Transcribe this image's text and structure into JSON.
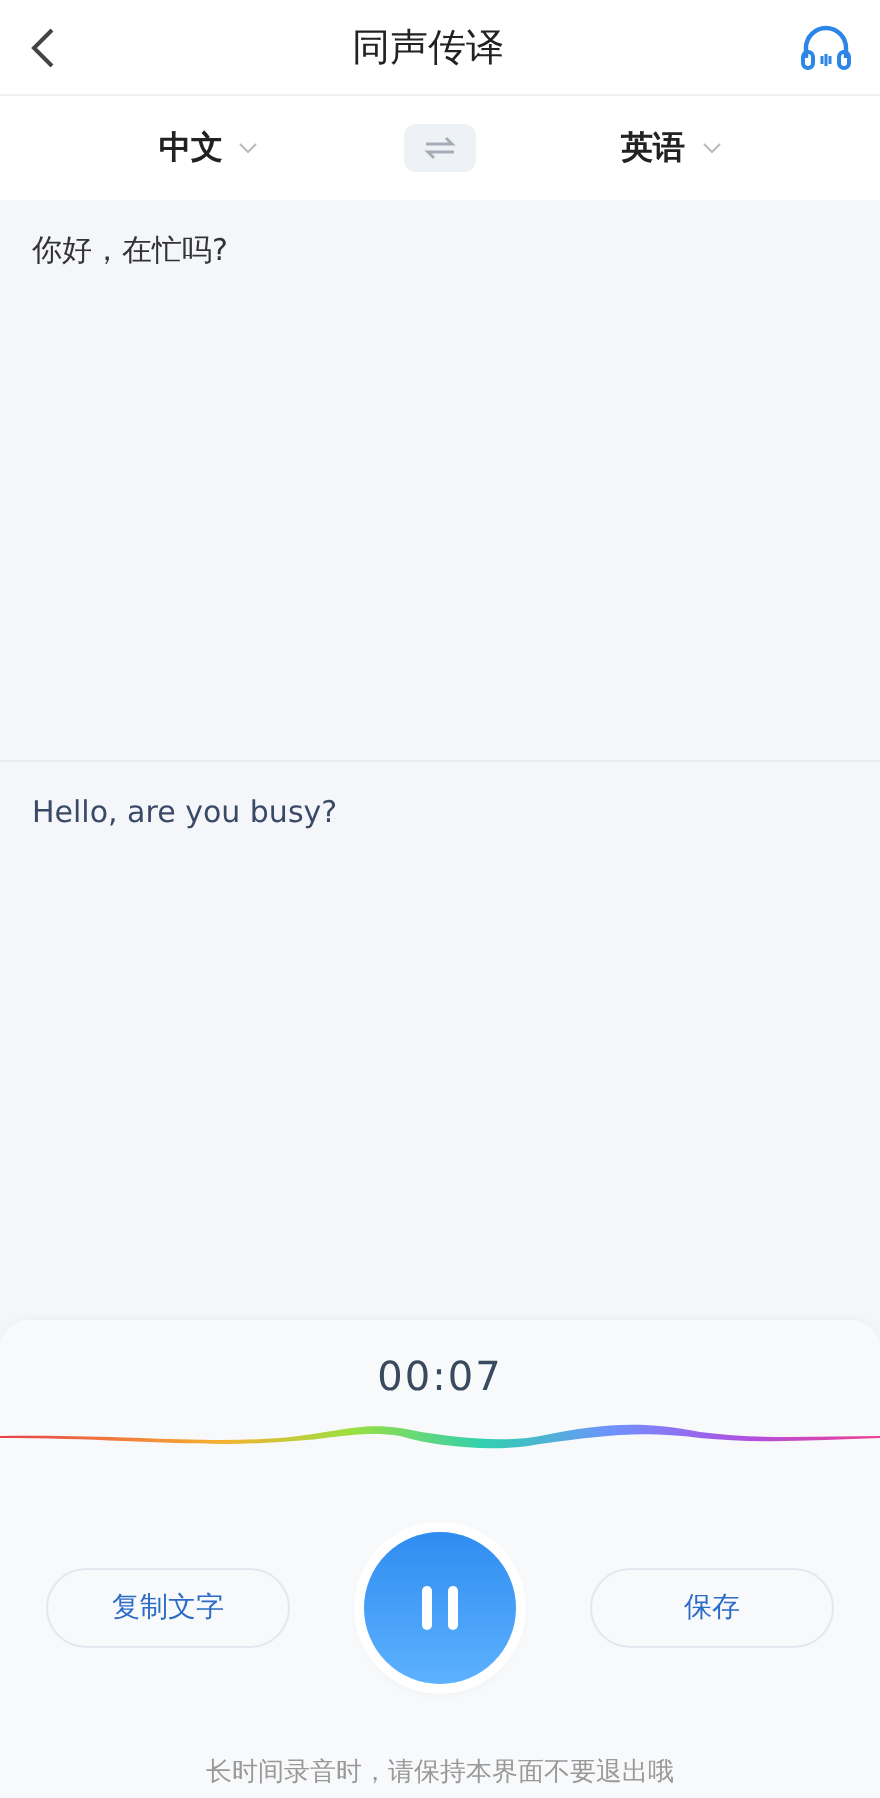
{
  "header": {
    "title": "同声传译"
  },
  "languages": {
    "source": "中文",
    "target": "英语"
  },
  "source_text": "你好，在忙吗?",
  "target_text": "Hello, are you busy?",
  "recorder": {
    "timer": "00:07",
    "buttons": [
      "复制文字",
      "保存"
    ],
    "hint": "长时间录音时，请保持本界面不要退出哦"
  }
}
